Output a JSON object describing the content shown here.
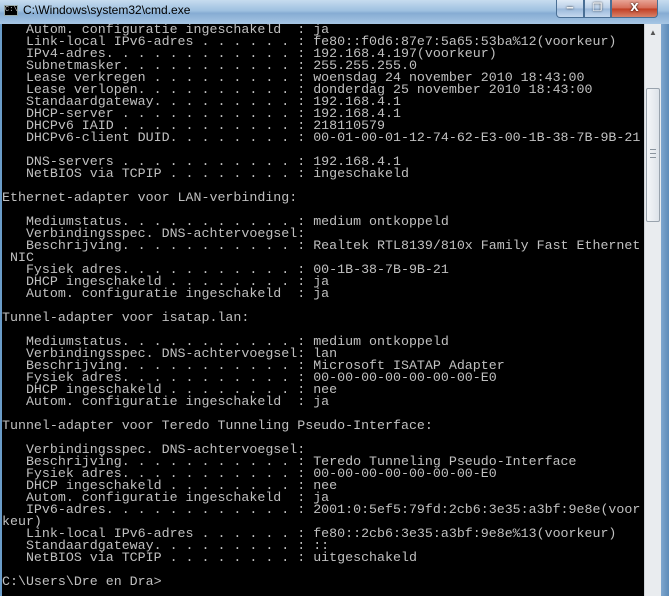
{
  "window": {
    "title": "C:\\Windows\\system32\\cmd.exe",
    "icon_text": "C:\\.",
    "minimize_glyph": "‒",
    "maximize_glyph": "❐",
    "close_glyph": "X"
  },
  "console": {
    "lines": [
      "   Autom. configuratie ingeschakeld  : ja",
      "   Link-local IPv6-adres . . . . . . : fe80::f0d6:87e7:5a65:53ba%12(voorkeur)",
      "   IPv4-adres. . . . . . . . . . . . : 192.168.4.197(voorkeur)",
      "   Subnetmasker. . . . . . . . . . . : 255.255.255.0",
      "   Lease verkregen . . . . . . . . . : woensdag 24 november 2010 18:43:00",
      "   Lease verlopen. . . . . . . . . . : donderdag 25 november 2010 18:43:00",
      "   Standaardgateway. . . . . . . . . : 192.168.4.1",
      "   DHCP-server . . . . . . . . . . . : 192.168.4.1",
      "   DHCPv6 IAID . . . . . . . . . . . : 218110579",
      "   DHCPv6-client DUID. . . . . . . . : 00-01-00-01-12-74-62-E3-00-1B-38-7B-9B-21",
      "",
      "   DNS-servers . . . . . . . . . . . : 192.168.4.1",
      "   NetBIOS via TCPIP . . . . . . . . : ingeschakeld",
      "",
      "Ethernet-adapter voor LAN-verbinding:",
      "",
      "   Mediumstatus. . . . . . . . . . . : medium ontkoppeld",
      "   Verbindingsspec. DNS-achtervoegsel:",
      "   Beschrijving. . . . . . . . . . . : Realtek RTL8139/810x Family Fast Ethernet",
      " NIC",
      "   Fysiek adres. . . . . . . . . . . : 00-1B-38-7B-9B-21",
      "   DHCP ingeschakeld . . . . . . . . : ja",
      "   Autom. configuratie ingeschakeld  : ja",
      "",
      "Tunnel-adapter voor isatap.lan:",
      "",
      "   Mediumstatus. . . . . . . . . . . : medium ontkoppeld",
      "   Verbindingsspec. DNS-achtervoegsel: lan",
      "   Beschrijving. . . . . . . . . . . : Microsoft ISATAP Adapter",
      "   Fysiek adres. . . . . . . . . . . : 00-00-00-00-00-00-00-E0",
      "   DHCP ingeschakeld . . . . . . . . : nee",
      "   Autom. configuratie ingeschakeld  : ja",
      "",
      "Tunnel-adapter voor Teredo Tunneling Pseudo-Interface:",
      "",
      "   Verbindingsspec. DNS-achtervoegsel:",
      "   Beschrijving. . . . . . . . . . . : Teredo Tunneling Pseudo-Interface",
      "   Fysiek adres. . . . . . . . . . . : 00-00-00-00-00-00-00-E0",
      "   DHCP ingeschakeld . . . . . . . . : nee",
      "   Autom. configuratie ingeschakeld  : ja",
      "   IPv6-adres. . . . . . . . . . . . : 2001:0:5ef5:79fd:2cb6:3e35:a3bf:9e8e(voor",
      "keur)",
      "   Link-local IPv6-adres . . . . . . : fe80::2cb6:3e35:a3bf:9e8e%13(voorkeur)",
      "   Standaardgateway. . . . . . . . . : ::",
      "   NetBIOS via TCPIP . . . . . . . . : uitgeschakeld",
      "",
      "C:\\Users\\Dre en Dra>"
    ]
  },
  "scrollbar": {
    "position_fraction": 0.9,
    "up_arrow_glyph": "▲"
  }
}
